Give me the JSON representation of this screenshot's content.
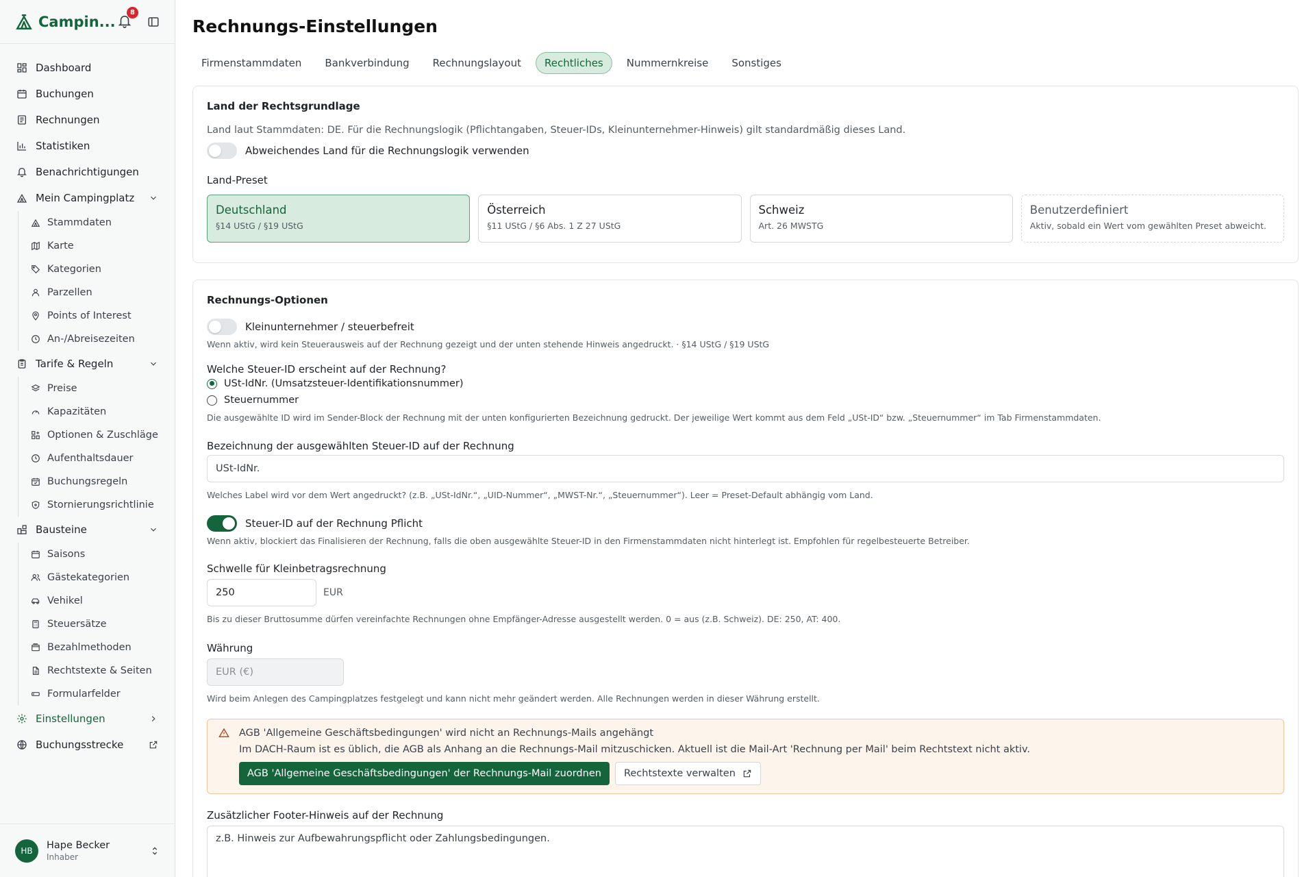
{
  "app": {
    "name": "Campin...",
    "notification_count": "8"
  },
  "sidebar": {
    "items": [
      {
        "label": "Dashboard"
      },
      {
        "label": "Buchungen"
      },
      {
        "label": "Rechnungen"
      },
      {
        "label": "Statistiken"
      },
      {
        "label": "Benachrichtigungen"
      },
      {
        "label": "Mein Campingplatz"
      },
      {
        "label": "Tarife & Regeln"
      },
      {
        "label": "Bausteine"
      },
      {
        "label": "Einstellungen"
      },
      {
        "label": "Buchungsstrecke"
      }
    ],
    "mein_campingplatz": [
      "Stammdaten",
      "Karte",
      "Kategorien",
      "Parzellen",
      "Points of Interest",
      "An-/Abreisezeiten"
    ],
    "tarife": [
      "Preise",
      "Kapazitäten",
      "Optionen & Zuschläge",
      "Aufenthaltsdauer",
      "Buchungsregeln",
      "Stornierungsrichtlinie"
    ],
    "bausteine": [
      "Saisons",
      "Gästekategorien",
      "Vehikel",
      "Steuersätze",
      "Bezahlmethoden",
      "Rechtstexte & Seiten",
      "Formularfelder"
    ]
  },
  "user": {
    "initials": "HB",
    "name": "Hape Becker",
    "role": "Inhaber"
  },
  "page": {
    "title": "Rechnungs-Einstellungen"
  },
  "tabs": [
    "Firmenstammdaten",
    "Bankverbindung",
    "Rechnungslayout",
    "Rechtliches",
    "Nummernkreise",
    "Sonstiges"
  ],
  "land": {
    "heading": "Land der Rechtsgrundlage",
    "description": "Land laut Stammdaten: DE. Für die Rechnungslogik (Pflichtangaben, Steuer-IDs, Kleinunternehmer-Hinweis) gilt standardmäßig dieses Land.",
    "toggle_label": "Abweichendes Land für die Rechnungslogik verwenden",
    "preset_label": "Land-Preset",
    "presets": [
      {
        "title": "Deutschland",
        "sub": "§14 UStG / §19 UStG"
      },
      {
        "title": "Österreich",
        "sub": "§11 UStG / §6 Abs. 1 Z 27 UStG"
      },
      {
        "title": "Schweiz",
        "sub": "Art. 26 MWSTG"
      },
      {
        "title": "Benutzerdefiniert",
        "sub": "Aktiv, sobald ein Wert vom gewählten Preset abweicht."
      }
    ]
  },
  "optionen": {
    "heading": "Rechnungs-Optionen",
    "klein_label": "Kleinunternehmer / steuerbefreit",
    "klein_help": "Wenn aktiv, wird kein Steuerausweis auf der Rechnung gezeigt und der unten stehende Hinweis angedruckt. · §14 UStG / §19 UStG",
    "steuerid_question": "Welche Steuer-ID erscheint auf der Rechnung?",
    "radio_ust": "USt-IdNr. (Umsatzsteuer-Identifikationsnummer)",
    "radio_steuer": "Steuernummer",
    "steuerid_help": "Die ausgewählte ID wird im Sender-Block der Rechnung mit der unten konfigurierten Bezeichnung gedruckt. Der jeweilige Wert kommt aus dem Feld „USt-ID“ bzw. „Steuernummer“ im Tab Firmenstammdaten.",
    "bez_label": "Bezeichnung der ausgewählten Steuer-ID auf der Rechnung",
    "bez_placeholder": "USt-IdNr.",
    "bez_help": "Welches Label wird vor dem Wert angedruckt? (z.B. „USt-IdNr.“, „UID-Nummer“, „MWST-Nr.“, „Steuernummer“). Leer = Preset-Default abhängig vom Land.",
    "pflicht_label": "Steuer-ID auf der Rechnung Pflicht",
    "pflicht_help": "Wenn aktiv, blockiert das Finalisieren der Rechnung, falls die oben ausgewählte Steuer-ID in den Firmenstammdaten nicht hinterlegt ist. Empfohlen für regelbesteuerte Betreiber.",
    "schwelle_label": "Schwelle für Kleinbetragsrechnung",
    "schwelle_value": "250",
    "schwelle_unit": "EUR",
    "schwelle_help": "Bis zu dieser Bruttosumme dürfen vereinfachte Rechnungen ohne Empfänger-Adresse ausgestellt werden. 0 = aus (z.B. Schweiz). DE: 250, AT: 400.",
    "waehrung_label": "Währung",
    "waehrung_value": "EUR (€)",
    "waehrung_help": "Wird beim Anlegen des Campingplatzes festgelegt und kann nicht mehr geändert werden. Alle Rechnungen werden in dieser Währung erstellt.",
    "alert_title": "AGB 'Allgemeine Geschäftsbedingungen' wird nicht an Rechnungs-Mails angehängt",
    "alert_body": "Im DACH-Raum ist es üblich, die AGB als Anhang an die Rechnungs-Mail mitzuschicken. Aktuell ist die Mail-Art 'Rechnung per Mail' beim Rechtstext nicht aktiv.",
    "alert_primary": "AGB 'Allgemeine Geschäftsbedingungen' der Rechnungs-Mail zuordnen",
    "alert_secondary": "Rechtstexte verwalten",
    "footer_label": "Zusätzlicher Footer-Hinweis auf der Rechnung",
    "footer_placeholder": "z.B. Hinweis zur Aufbewahrungspflicht oder Zahlungsbedingungen."
  }
}
